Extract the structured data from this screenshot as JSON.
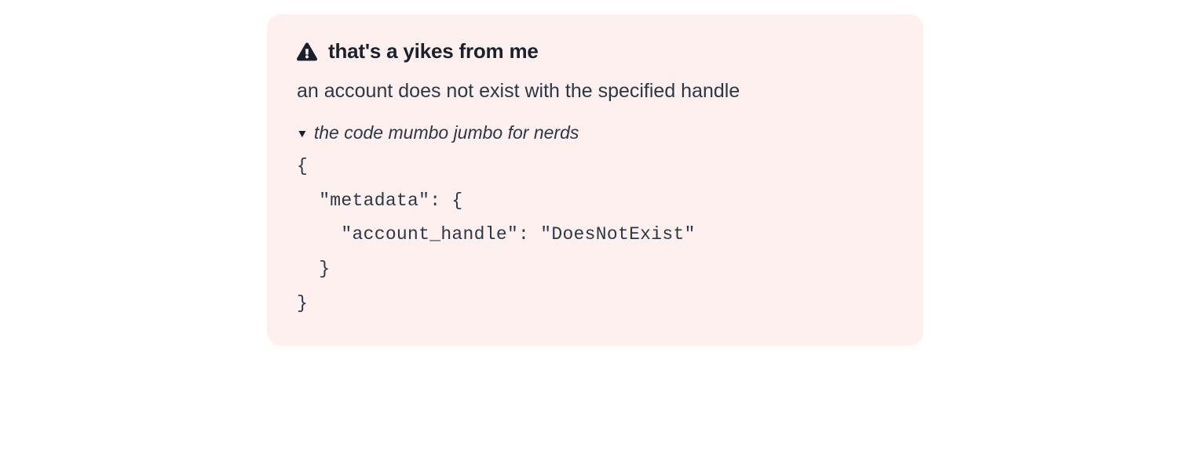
{
  "error_panel": {
    "title": "that's a yikes from me",
    "message": "an account does not exist with the specified handle",
    "details_label": "the code mumbo jumbo for nerds",
    "code": "{\n  \"metadata\": {\n    \"account_handle\": \"DoesNotExist\"\n  }\n}"
  }
}
